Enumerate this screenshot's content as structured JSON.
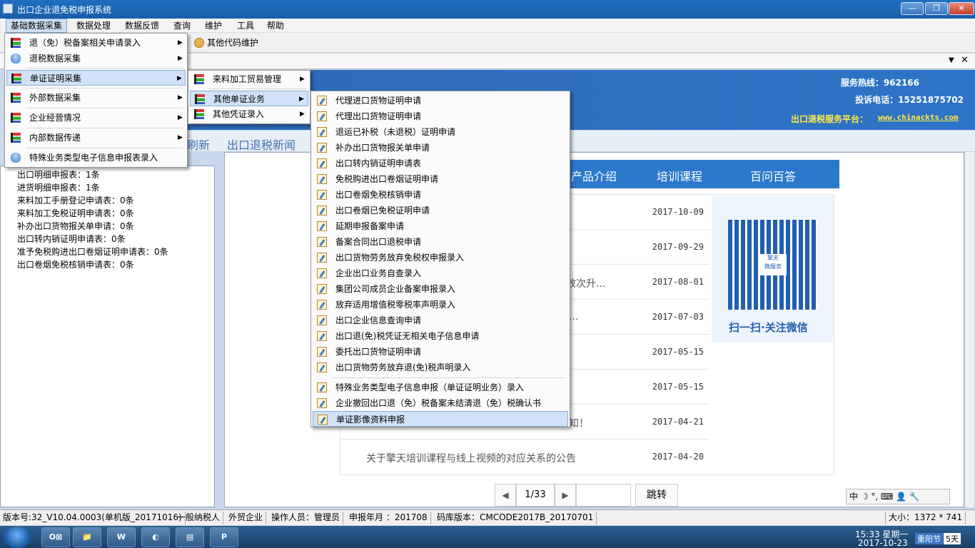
{
  "window": {
    "title": "出口企业退免税申报系统",
    "min": "—",
    "restore": "❐",
    "close": "✕"
  },
  "menubar": [
    "基础数据采集",
    "数据处理",
    "数据反馈",
    "查询",
    "维护",
    "工具",
    "帮助"
  ],
  "toolbar": {
    "other_code": "其他代码维护"
  },
  "tabstrip": {
    "down": "▼",
    "close": "✕"
  },
  "banner": {
    "hotline": "服务热线：962166",
    "complaint": "投诉电话：15251875702",
    "platform_label": "出口退税服务平台：",
    "platform_url": "www.chinackts.com"
  },
  "nav": {
    "refresh": "刷新",
    "news": "出口退税新闻"
  },
  "left_stats": [
    "出口明细申报表：1条",
    "进货明细申报表：1条",
    "来料加工手册登记申请表：0条",
    "来料加工免税证明申请表：0条",
    "补办出口货物报关单申请：0条",
    "出口转内销证明申请表：0条",
    "准予免税购进出口卷烟证明申请表：0条",
    "出口卷烟免税核销申请表：0条"
  ],
  "blue_tabs": [
    "产品介绍",
    "培训课程",
    "百问百答"
  ],
  "news": [
    {
      "title": "",
      "date": "2017-10-09"
    },
    {
      "title": "",
      "date": "2017-09-29"
    },
    {
      "title": "效次升...",
      "date": "2017-08-01"
    },
    {
      "title": "...",
      "date": "2017-07-03"
    },
    {
      "title": "",
      "date": "2017-05-15"
    },
    {
      "title": "",
      "date": "2017-05-15"
    },
    {
      "title": "知！",
      "date": "2017-04-21"
    },
    {
      "title": "关于擎天培训课程与线上视频的对应关系的公告",
      "date": "2017-04-20"
    }
  ],
  "qr": {
    "center_text": "擎天\n微服务",
    "caption": "扫一扫·关注微信"
  },
  "pager": {
    "prev": "◀",
    "page": "1/33",
    "next": "▶",
    "go": "跳转",
    "input_value": ""
  },
  "ime": "中 ☽ °, ⌨ 👤 🔧",
  "status": [
    "版本号:32_V10.04.0003(单机版_20171016)",
    "一般纳税人",
    "外贸企业",
    "操作人员：管理员",
    "申报年月 ：201708",
    "码库版本：CMCODE2017B_20170701",
    "大小：1372 * 741"
  ],
  "taskbar": {
    "apps": [
      "O⊠",
      "📁",
      "W",
      "◐",
      "▤",
      "P"
    ],
    "time": "15:33 星期一",
    "date": "2017-10-23",
    "festival": "重阳节",
    "days": "5天"
  },
  "menu1": [
    {
      "label": "退（免）税备案相关申请录入",
      "sub": true,
      "icon": "bar-icon"
    },
    {
      "label": "退税数据采集",
      "sub": true,
      "icon": "db-icon"
    },
    {
      "label": "单证证明采集",
      "sub": true,
      "icon": "bar-icon",
      "selected": true
    },
    {
      "label": "外部数据采集",
      "sub": true,
      "icon": "bar-icon"
    },
    {
      "label": "企业经营情况",
      "sub": true,
      "icon": "bar-icon"
    },
    {
      "label": "内部数据传递",
      "sub": true,
      "icon": "bar-icon"
    },
    {
      "label": "特殊业务类型电子信息申报表录入",
      "sub": false,
      "icon": "db-icon"
    }
  ],
  "menu2": [
    {
      "label": "来料加工贸易管理",
      "sub": true
    },
    {
      "label": "其他单证业务",
      "sub": true,
      "selected": true
    },
    {
      "label": "其他凭证录入",
      "sub": true
    }
  ],
  "menu3": [
    "代理进口货物证明申请",
    "代理出口货物证明申请",
    "退运已补税（未退税）证明申请",
    "补办出口货物报关单申请",
    "出口转内销证明申请表",
    "免税购进出口卷烟证明申请",
    "出口卷烟免税核销申请",
    "出口卷烟已免税证明申请",
    "延期申报备案申请",
    "备案合同出口退税申请",
    "出口货物劳务放弃免税权申报录入",
    "企业出口业务自查录入",
    "集团公司成员企业备案申报录入",
    "放弃适用增值税零税率声明录入",
    "出口企业信息查询申请",
    "出口退(免)税凭证无相关电子信息申请",
    "委托出口货物证明申请",
    "出口货物劳务放弃退(免)税声明录入",
    "特殊业务类型电子信息申报（单证证明业务）录入",
    "企业撤回出口退（免）税备案未结清退（免）税确认书",
    "单证影像资料申报"
  ],
  "colors": {
    "banner": "#2f69b5",
    "accent_yellow": "#ffe94a",
    "tab_blue": "#2b78cc"
  }
}
